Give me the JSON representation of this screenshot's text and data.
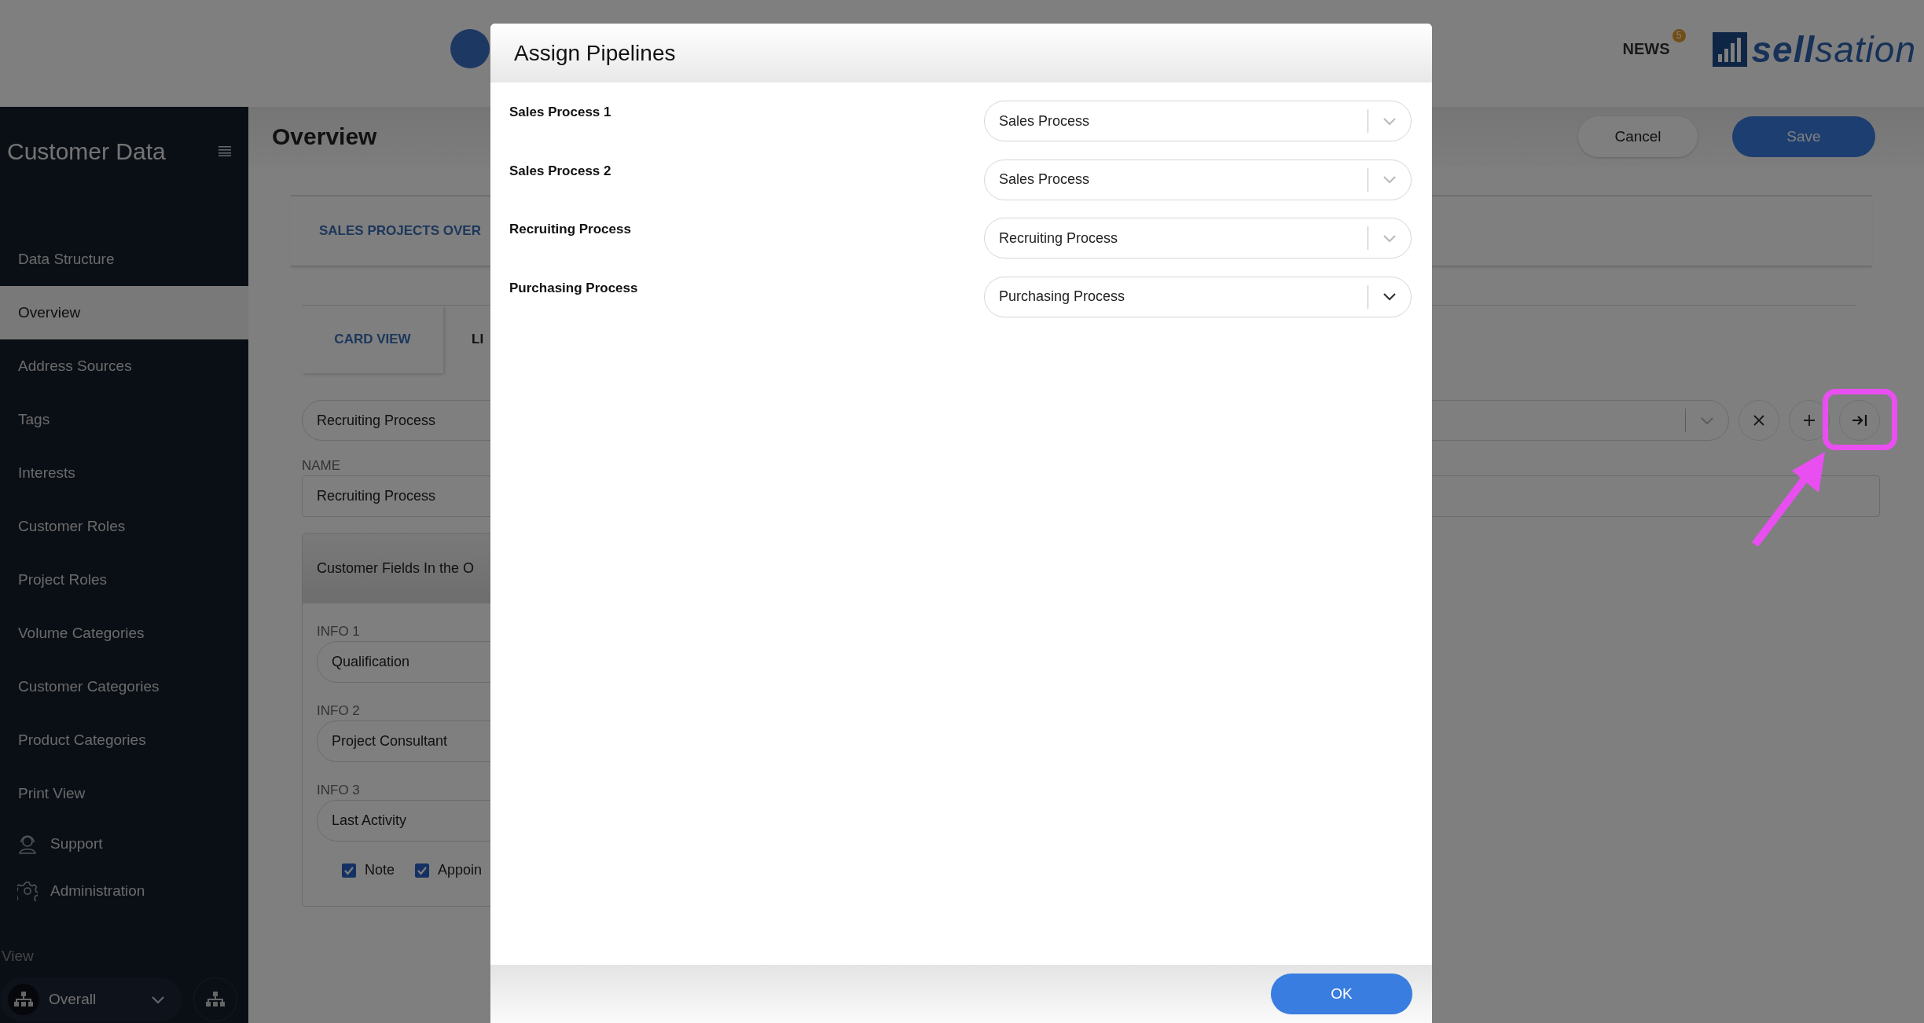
{
  "header": {
    "news_label": "NEWS",
    "news_badge": "5",
    "logo_text": "**sell**sation"
  },
  "sidebar": {
    "title": "Customer Data",
    "items": [
      {
        "label": "Data Structure",
        "kind": "plain",
        "selected": false
      },
      {
        "label": "Overview",
        "kind": "plain",
        "selected": true
      },
      {
        "label": "Address Sources",
        "kind": "plain",
        "selected": false
      },
      {
        "label": "Tags",
        "kind": "plain",
        "selected": false
      },
      {
        "label": "Interests",
        "kind": "plain",
        "selected": false
      },
      {
        "label": "Customer Roles",
        "kind": "plain",
        "selected": false
      },
      {
        "label": "Project Roles",
        "kind": "plain",
        "selected": false
      },
      {
        "label": "Volume Categories",
        "kind": "plain",
        "selected": false
      },
      {
        "label": "Customer Categories",
        "kind": "plain",
        "selected": false
      },
      {
        "label": "Product Categories",
        "kind": "plain",
        "selected": false
      },
      {
        "label": "Print View",
        "kind": "plain",
        "selected": false
      },
      {
        "label": "Support",
        "kind": "support",
        "selected": false
      },
      {
        "label": "Administration",
        "kind": "settings",
        "selected": false
      }
    ],
    "view_label": "View",
    "view_select": {
      "value": "Overall"
    }
  },
  "page": {
    "title": "Overview",
    "buttons": [
      {
        "label": "Cancel",
        "kind": "secondary"
      },
      {
        "label": "Save",
        "kind": "primary"
      }
    ]
  },
  "section_tabs": [
    {
      "label": "SALES PROJECTS OVER",
      "selected": true
    }
  ],
  "view_tabs": [
    {
      "label": "CARD VIEW",
      "selected": true
    },
    {
      "label": "LI",
      "selected": false
    }
  ],
  "pipeline_select": {
    "value": "Recruiting Process"
  },
  "actions": [
    {
      "kind": "clear",
      "highlighted": false
    },
    {
      "kind": "add",
      "highlighted": false
    },
    {
      "kind": "assign",
      "highlighted": true
    }
  ],
  "name_field": {
    "label": "NAME",
    "value": "Recruiting Process"
  },
  "fields_panel": {
    "title": "Customer Fields In the O",
    "infos": [
      {
        "label": "INFO 1",
        "value": "Qualification"
      },
      {
        "label": "INFO 2",
        "value": "Project Consultant"
      },
      {
        "label": "INFO 3",
        "value": "Last Activity"
      }
    ],
    "checkboxes": [
      {
        "label": "Note",
        "checked": true
      },
      {
        "label": "Appoin",
        "checked": true
      }
    ]
  },
  "dialog": {
    "title": "Assign Pipelines",
    "rows": [
      {
        "label": "Sales Process 1",
        "value": "Sales Process",
        "hover": false
      },
      {
        "label": "Sales Process 2",
        "value": "Sales Process",
        "hover": false
      },
      {
        "label": "Recruiting Process",
        "value": "Recruiting Process",
        "hover": false
      },
      {
        "label": "Purchasing Process",
        "value": "Purchasing Process",
        "hover": true
      }
    ],
    "ok_button": "OK"
  }
}
